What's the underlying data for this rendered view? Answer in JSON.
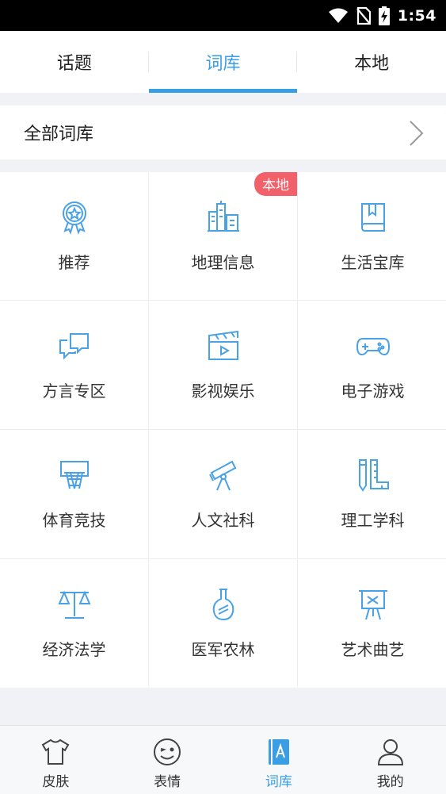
{
  "status": {
    "time": "1:54"
  },
  "tabs": [
    {
      "label": "话题",
      "active": false
    },
    {
      "label": "词库",
      "active": true
    },
    {
      "label": "本地",
      "active": false
    }
  ],
  "all_library": {
    "label": "全部词库"
  },
  "categories": [
    {
      "label": "推荐",
      "icon": "award-ribbon-icon"
    },
    {
      "label": "地理信息",
      "icon": "city-buildings-icon",
      "badge": "本地"
    },
    {
      "label": "生活宝库",
      "icon": "book-icon"
    },
    {
      "label": "方言专区",
      "icon": "chat-bubbles-icon"
    },
    {
      "label": "影视娱乐",
      "icon": "film-clapper-icon"
    },
    {
      "label": "电子游戏",
      "icon": "gamepad-icon"
    },
    {
      "label": "体育竞技",
      "icon": "basketball-hoop-icon"
    },
    {
      "label": "人文社科",
      "icon": "telescope-icon"
    },
    {
      "label": "理工学科",
      "icon": "pencil-ruler-icon"
    },
    {
      "label": "经济法学",
      "icon": "balance-scale-icon"
    },
    {
      "label": "医军农林",
      "icon": "flask-icon"
    },
    {
      "label": "艺术曲艺",
      "icon": "easel-icon"
    }
  ],
  "bottom_nav": [
    {
      "label": "皮肤",
      "icon": "tshirt-icon",
      "active": false
    },
    {
      "label": "表情",
      "icon": "wink-face-icon",
      "active": false
    },
    {
      "label": "词库",
      "icon": "dictionary-book-icon",
      "active": true
    },
    {
      "label": "我的",
      "icon": "user-icon",
      "active": false
    }
  ],
  "colors": {
    "accent": "#3a9ee4",
    "badge": "#f2616a",
    "icon_stroke": "#4aa2e6"
  }
}
